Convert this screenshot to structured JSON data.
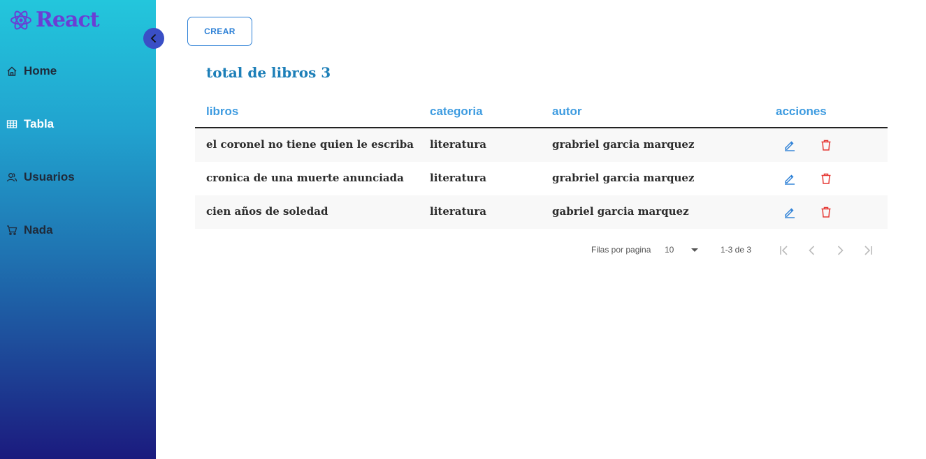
{
  "brand": {
    "name": "React",
    "color": "#6a3fd4"
  },
  "sidebar": {
    "items": [
      {
        "label": "Home",
        "icon": "home-icon"
      },
      {
        "label": "Tabla",
        "icon": "table-icon",
        "active": true
      },
      {
        "label": "Usuarios",
        "icon": "users-icon"
      },
      {
        "label": "Nada",
        "icon": "cart-icon"
      }
    ]
  },
  "toolbar": {
    "create_label": "CREAR"
  },
  "main": {
    "title": "total de libros 3"
  },
  "table": {
    "columns": [
      "libros",
      "categoria",
      "autor",
      "acciones"
    ],
    "rows": [
      {
        "libro": "el coronel no tiene quien le escriba",
        "categoria": "literatura",
        "autor": "grabriel garcia marquez"
      },
      {
        "libro": "cronica de una muerte anunciada",
        "categoria": "literatura",
        "autor": "grabriel garcia marquez"
      },
      {
        "libro": "cien años de soledad",
        "categoria": "literatura",
        "autor": "gabriel garcia marquez"
      }
    ]
  },
  "pagination": {
    "rows_per_page_label": "Filas por pagina",
    "rows_per_page": "10",
    "range": "1-3 de 3"
  },
  "colors": {
    "accent": "#2b7fd6",
    "header": "#3d9be0",
    "delete": "#e53935",
    "title": "#1d7fb8"
  }
}
